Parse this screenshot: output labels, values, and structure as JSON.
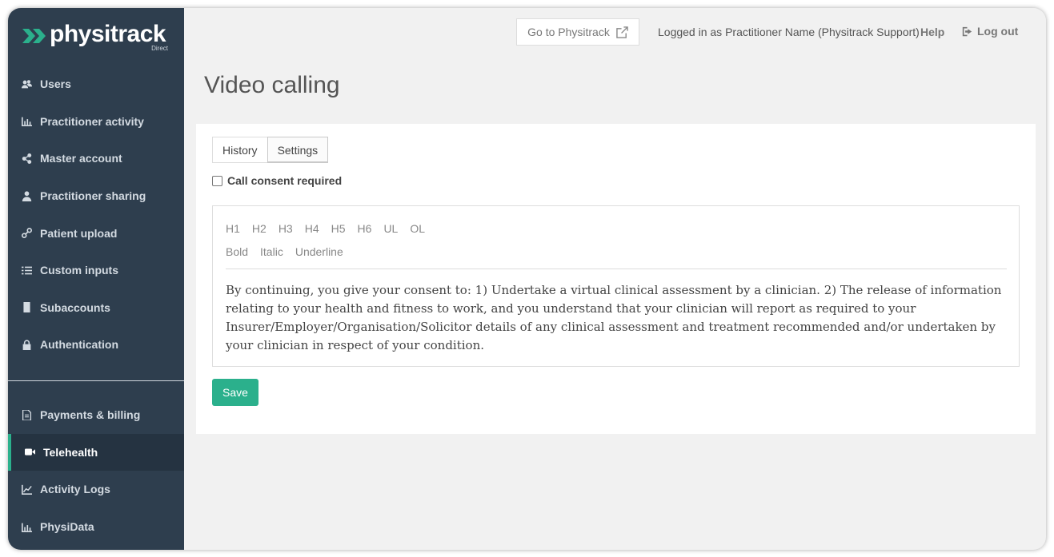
{
  "brand": {
    "name": "physitrack",
    "sub": "Direct",
    "accent": "#2bb08c",
    "sidebar_bg": "#2e3e4e"
  },
  "sidebar": {
    "items": [
      {
        "label": "Users",
        "icon": "users-icon"
      },
      {
        "label": "Practitioner activity",
        "icon": "bar-chart-icon"
      },
      {
        "label": "Master account",
        "icon": "share-icon"
      },
      {
        "label": "Practitioner sharing",
        "icon": "user-icon"
      },
      {
        "label": "Patient upload",
        "icon": "link-icon"
      },
      {
        "label": "Custom inputs",
        "icon": "list-icon"
      },
      {
        "label": "Subaccounts",
        "icon": "building-icon"
      },
      {
        "label": "Authentication",
        "icon": "lock-icon"
      }
    ],
    "bottom_items": [
      {
        "label": "Payments & billing",
        "icon": "document-icon"
      },
      {
        "label": "Telehealth",
        "icon": "video-camera-icon",
        "active": true
      },
      {
        "label": "Activity Logs",
        "icon": "line-chart-icon"
      },
      {
        "label": "PhysiData",
        "icon": "bar-chart-icon"
      }
    ]
  },
  "topbar": {
    "goto_label": "Go to Physitrack",
    "logged_in": "Logged in as Practitioner Name (Physitrack Support)",
    "help": "Help",
    "logout": "Log out"
  },
  "page": {
    "title": "Video calling"
  },
  "tabs": [
    {
      "label": "History"
    },
    {
      "label": "Settings",
      "active": true
    }
  ],
  "consent": {
    "label": "Call consent required",
    "checked": false
  },
  "editor": {
    "toolbar_row1": [
      "H1",
      "H2",
      "H3",
      "H4",
      "H5",
      "H6",
      "UL",
      "OL"
    ],
    "toolbar_row2": [
      "Bold",
      "Italic",
      "Underline"
    ],
    "content": "By continuing, you give your consent to:  1) Undertake a virtual clinical assessment by a clinician.  2) The release of information relating to your health and fitness to work, and you understand that your clinician will report as required to your Insurer/Employer/Organisation/Solicitor details of any clinical assessment and treatment recommended and/or undertaken by your clinician in respect of your condition."
  },
  "save_label": "Save"
}
